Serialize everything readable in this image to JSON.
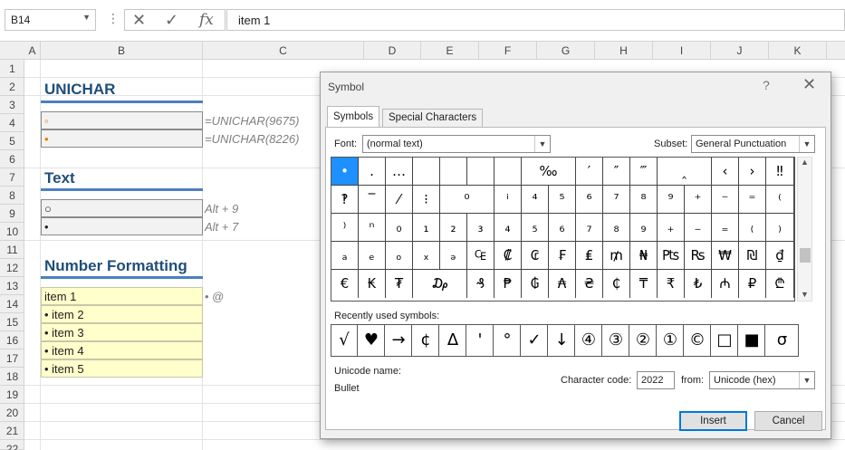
{
  "formula_bar": {
    "name_box": "B14",
    "dots": "⋮",
    "cancel": "✕",
    "enter": "✓",
    "fx": "fx",
    "value": "item 1"
  },
  "columns": [
    "A",
    "B",
    "C",
    "D",
    "E",
    "F",
    "G",
    "H",
    "I",
    "J",
    "K"
  ],
  "rows": [
    "1",
    "2",
    "3",
    "4",
    "5",
    "6",
    "7",
    "8",
    "9",
    "10",
    "11",
    "12",
    "13",
    "14",
    "15",
    "16",
    "17",
    "18",
    "19",
    "20",
    "21",
    "22"
  ],
  "sheet": {
    "unichar_title": "UNICHAR",
    "unichar_cells": [
      "◦",
      "•"
    ],
    "unichar_notes": [
      "=UNICHAR(9675)",
      "=UNICHAR(8226)"
    ],
    "text_title": "Text",
    "text_cells": [
      "○",
      "•"
    ],
    "text_notes": [
      "Alt + 9",
      "Alt + 7"
    ],
    "numfmt_title": "Number Formatting",
    "numfmt_cells": [
      "item 1",
      "• item 2",
      "• item 3",
      "• item 4",
      "• item 5"
    ],
    "numfmt_note": "• @"
  },
  "dialog": {
    "title": "Symbol",
    "help": "?",
    "close": "✕",
    "tabs": [
      "Symbols",
      "Special Characters"
    ],
    "font_label": "Font:",
    "font_value": "(normal text)",
    "subset_label": "Subset:",
    "subset_value": "General Punctuation",
    "symbols": [
      [
        "•",
        "․",
        "…",
        "",
        "",
        "",
        "",
        "‰",
        "′",
        "″",
        "‴",
        "‸",
        "‹",
        "›",
        "‼"
      ],
      [
        "‽",
        "‾",
        "⁄",
        "⁝",
        "⁰",
        "ⁱ",
        "⁴",
        "⁵",
        "⁶",
        "⁷",
        "⁸",
        "⁹",
        "⁺",
        "⁻",
        "⁼",
        "⁽"
      ],
      [
        "⁾",
        "ⁿ",
        "₀",
        "₁",
        "₂",
        "₃",
        "₄",
        "₅",
        "₆",
        "₇",
        "₈",
        "₉",
        "₊",
        "₋",
        "₌",
        "₍",
        "₎"
      ],
      [
        "ₐ",
        "ₑ",
        "ₒ",
        "ₓ",
        "ₔ",
        "₠",
        "₡",
        "₢",
        "₣",
        "₤",
        "₥",
        "₦",
        "₧",
        "₨",
        "₩",
        "₪",
        "₫"
      ],
      [
        "€",
        "₭",
        "₮",
        "₯",
        "₰",
        "₱",
        "₲",
        "₳",
        "₴",
        "₵",
        "₸",
        "₹",
        "₺",
        "₼",
        "₽",
        "₾"
      ]
    ],
    "recent_label": "Recently used symbols:",
    "recent": [
      "√",
      "♥",
      "→",
      "¢",
      "Δ",
      "'",
      "°",
      "✓",
      "↓",
      "④",
      "③",
      "②",
      "①",
      "©",
      "□",
      "■",
      "σ"
    ],
    "unicode_name_label": "Unicode name:",
    "unicode_name": "Bullet",
    "charcode_label": "Character code:",
    "charcode_value": "2022",
    "from_label": "from:",
    "from_value": "Unicode (hex)",
    "insert_label": "Insert",
    "cancel_label": "Cancel"
  }
}
